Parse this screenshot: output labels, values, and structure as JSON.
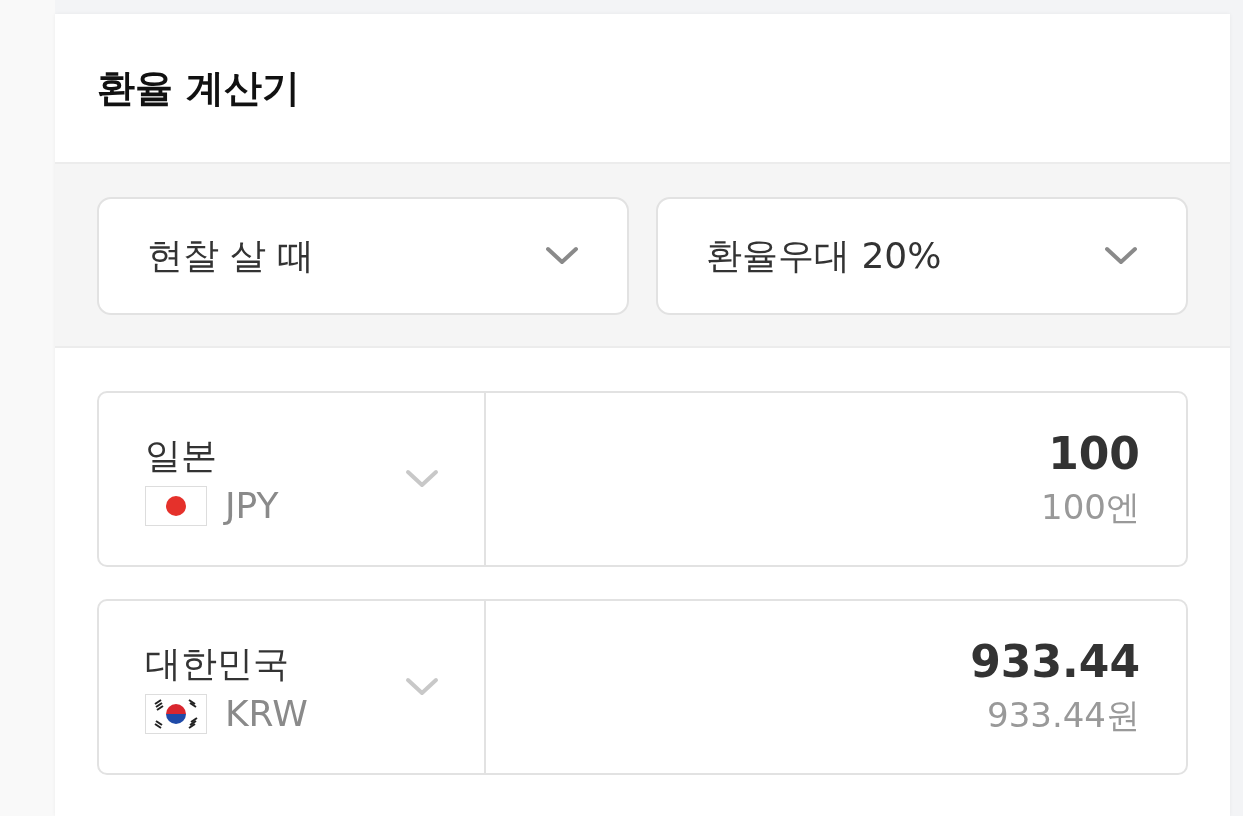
{
  "title": "환율 계산기",
  "options": [
    {
      "label": "현찰 살 때"
    },
    {
      "label": "환율우대 20%"
    }
  ],
  "currencies": [
    {
      "country": "일본",
      "code": "JPY",
      "kind": "japan",
      "amount": "100",
      "amount_text": "100엔"
    },
    {
      "country": "대한민국",
      "code": "KRW",
      "kind": "korea",
      "amount": "933.44",
      "amount_text": "933.44원"
    }
  ]
}
